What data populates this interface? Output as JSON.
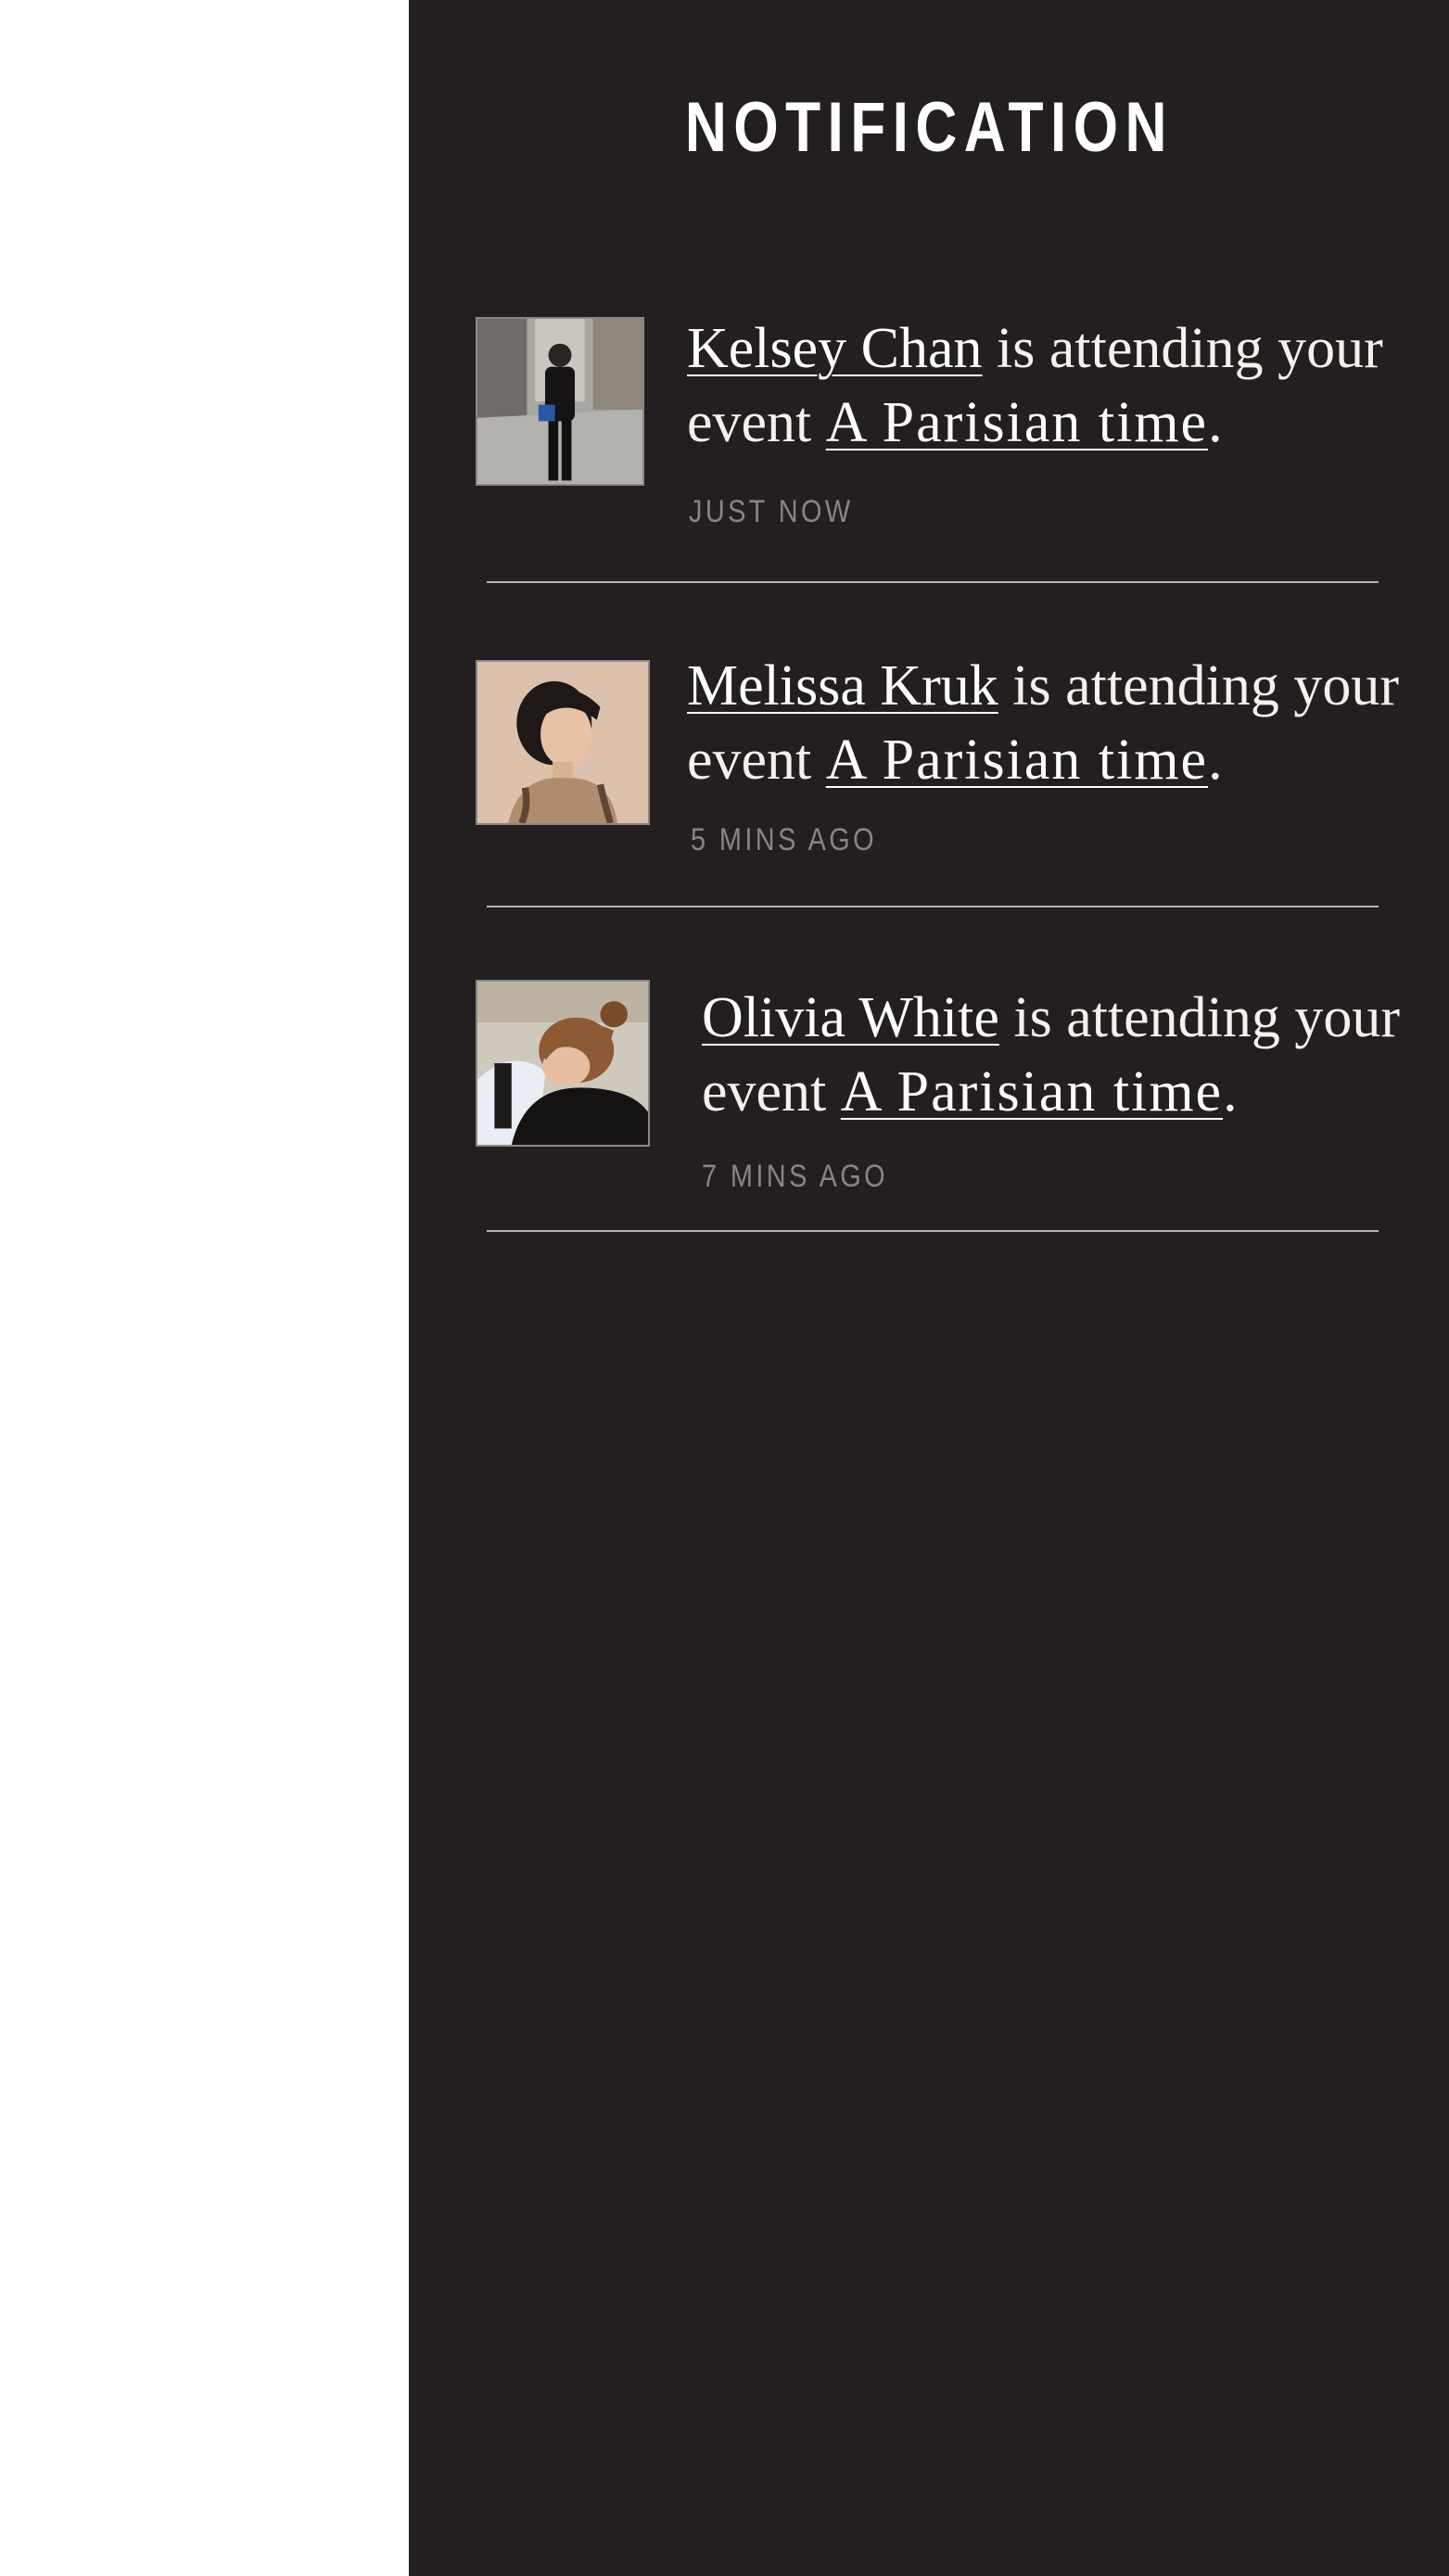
{
  "header": {
    "title": "NOTIFICATION"
  },
  "notifications": [
    {
      "user_name": "Kelsey Chan",
      "action_text": "is attending your event",
      "event_name": "A Parisian time",
      "punct": ".",
      "timestamp": "JUST NOW",
      "avatar_icon": "person-street-photo"
    },
    {
      "user_name": "Melissa Kruk",
      "action_text": "is attending your event",
      "event_name": "A Parisian time",
      "punct": ".",
      "timestamp": "5 MINS AGO",
      "avatar_icon": "woman-portrait-photo"
    },
    {
      "user_name": "Olivia White",
      "action_text": "is attending your event",
      "event_name": "A Parisian time",
      "punct": ".",
      "timestamp": "7 MINS AGO",
      "avatar_icon": "woman-hair-bun-photo"
    }
  ],
  "colors": {
    "panel_background": "#231f20",
    "page_background": "#fdfdfd",
    "timestamp_text": "#8a8584",
    "divider": "#b8b4b2"
  }
}
